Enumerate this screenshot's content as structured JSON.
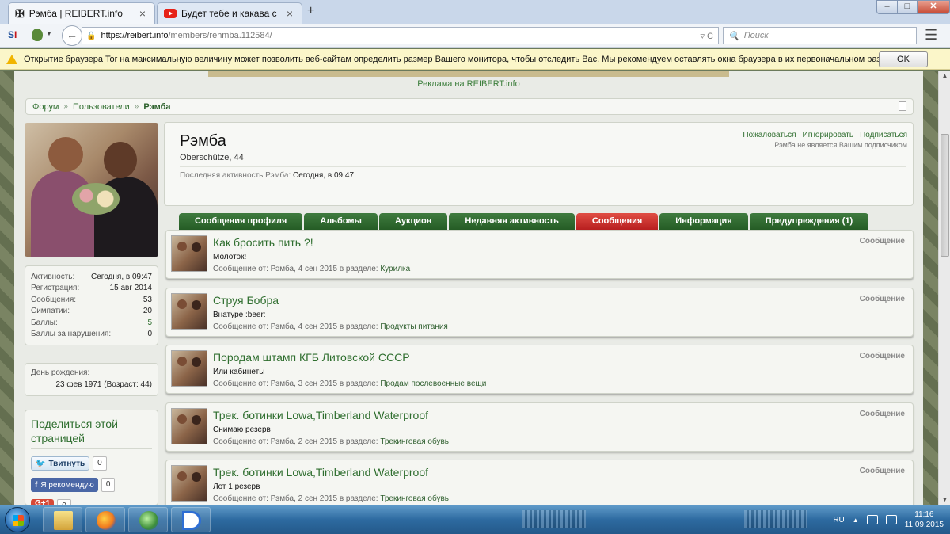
{
  "browser": {
    "tabs": [
      {
        "title": "Рэмба | REIBERT.info",
        "close": "×"
      },
      {
        "title": "Будет тебе и какава с чае...",
        "close": "×"
      }
    ],
    "new_tab": "+",
    "window_buttons": {
      "minimize": "–",
      "maximize": "□",
      "close": "✕"
    },
    "url_host": "https://reibert.info",
    "url_path": "/members/rehmba.112584/",
    "url_controls": "▿ C",
    "search_placeholder": "Поиск",
    "search_icon": "search-icon",
    "menu_icon": "☰",
    "back_icon": "←",
    "s_logo_a": "S",
    "s_logo_b": "I",
    "notification": {
      "text": "Открытие браузера Tor на максимальную величину может позволить веб-сайтам определить размер Вашего монитора, чтобы отследить Вас. Мы рекомендуем оставлять окна браузера в их первоначальном размере.",
      "ok": "OK"
    }
  },
  "site": {
    "ad_label": "Реклама на REIBERT.info",
    "breadcrumb": [
      "Форум",
      "Пользователи",
      "Рэмба"
    ],
    "breadcrumb_sep": "»"
  },
  "sidebar": {
    "stats": [
      {
        "label": "Активность:",
        "value": "Сегодня, в 09:47"
      },
      {
        "label": "Регистрация:",
        "value": "15 авг 2014"
      },
      {
        "label": "Сообщения:",
        "value": "53"
      },
      {
        "label": "Симпатии:",
        "value": "20"
      },
      {
        "label": "Баллы:",
        "value": "5"
      },
      {
        "label": "Баллы за нарушения:",
        "value": "0"
      }
    ],
    "birthday_label": "День рождения:",
    "birthday_value": "23 фев 1971 (Возраст: 44)",
    "share_title": "Поделиться этой страницей",
    "tweet_label": "Твитнуть",
    "tweet_count": "0",
    "fb_label": "Я рекомендую",
    "fb_count": "0",
    "gplus_label": "G+1",
    "gplus_count": "0"
  },
  "profile": {
    "name": "Рэмба",
    "location": "Oberschütze, 44",
    "activity_label": "Последняя активность Рэмба:",
    "activity_value": "Сегодня, в 09:47",
    "actions": [
      "Пожаловаться",
      "Игнорировать",
      "Подписаться"
    ],
    "note": "Рэмба не является Вашим подписчиком"
  },
  "tabs": [
    "Сообщения профиля",
    "Альбомы",
    "Аукцион",
    "Недавняя активность",
    "Сообщения",
    "Информация",
    "Предупреждения (1)"
  ],
  "active_tab": "Сообщения",
  "posts": [
    {
      "title": "Как бросить пить ?!",
      "snippet": "Молоток!",
      "meta_prefix": "Сообщение от: Рэмба, 4 сен 2015 в разделе:",
      "forum": "Курилка",
      "type": "Сообщение"
    },
    {
      "title": "Струя Бобра",
      "snippet": "Внатуре :beer:",
      "meta_prefix": "Сообщение от: Рэмба, 4 сен 2015 в разделе:",
      "forum": "Продукты питания",
      "type": "Сообщение"
    },
    {
      "title": "Породам штамп КГБ Литовской СССР",
      "snippet": "Или кабинеты",
      "meta_prefix": "Сообщение от: Рэмба, 3 сен 2015 в разделе:",
      "forum": "Продам послевоенные вещи",
      "type": "Сообщение"
    },
    {
      "title": "Трек. ботинки Lowa,Timberland Waterproof",
      "snippet": "Снимаю резерв",
      "meta_prefix": "Сообщение от: Рэмба, 2 сен 2015 в разделе:",
      "forum": "Трекинговая обувь",
      "type": "Сообщение"
    },
    {
      "title": "Трек. ботинки Lowa,Timberland Waterproof",
      "snippet": "Лот 1 резерв",
      "meta_prefix": "Сообщение от: Рэмба, 2 сен 2015 в разделе:",
      "forum": "Трекинговая обувь",
      "type": "Сообщение"
    }
  ],
  "taskbar": {
    "lang": "RU",
    "time": "11:16",
    "date": "11.09.2015"
  },
  "colors": {
    "link_green": "#2f6e2f",
    "tab_green": "#255c25",
    "tab_active_red": "#b81f1f"
  }
}
